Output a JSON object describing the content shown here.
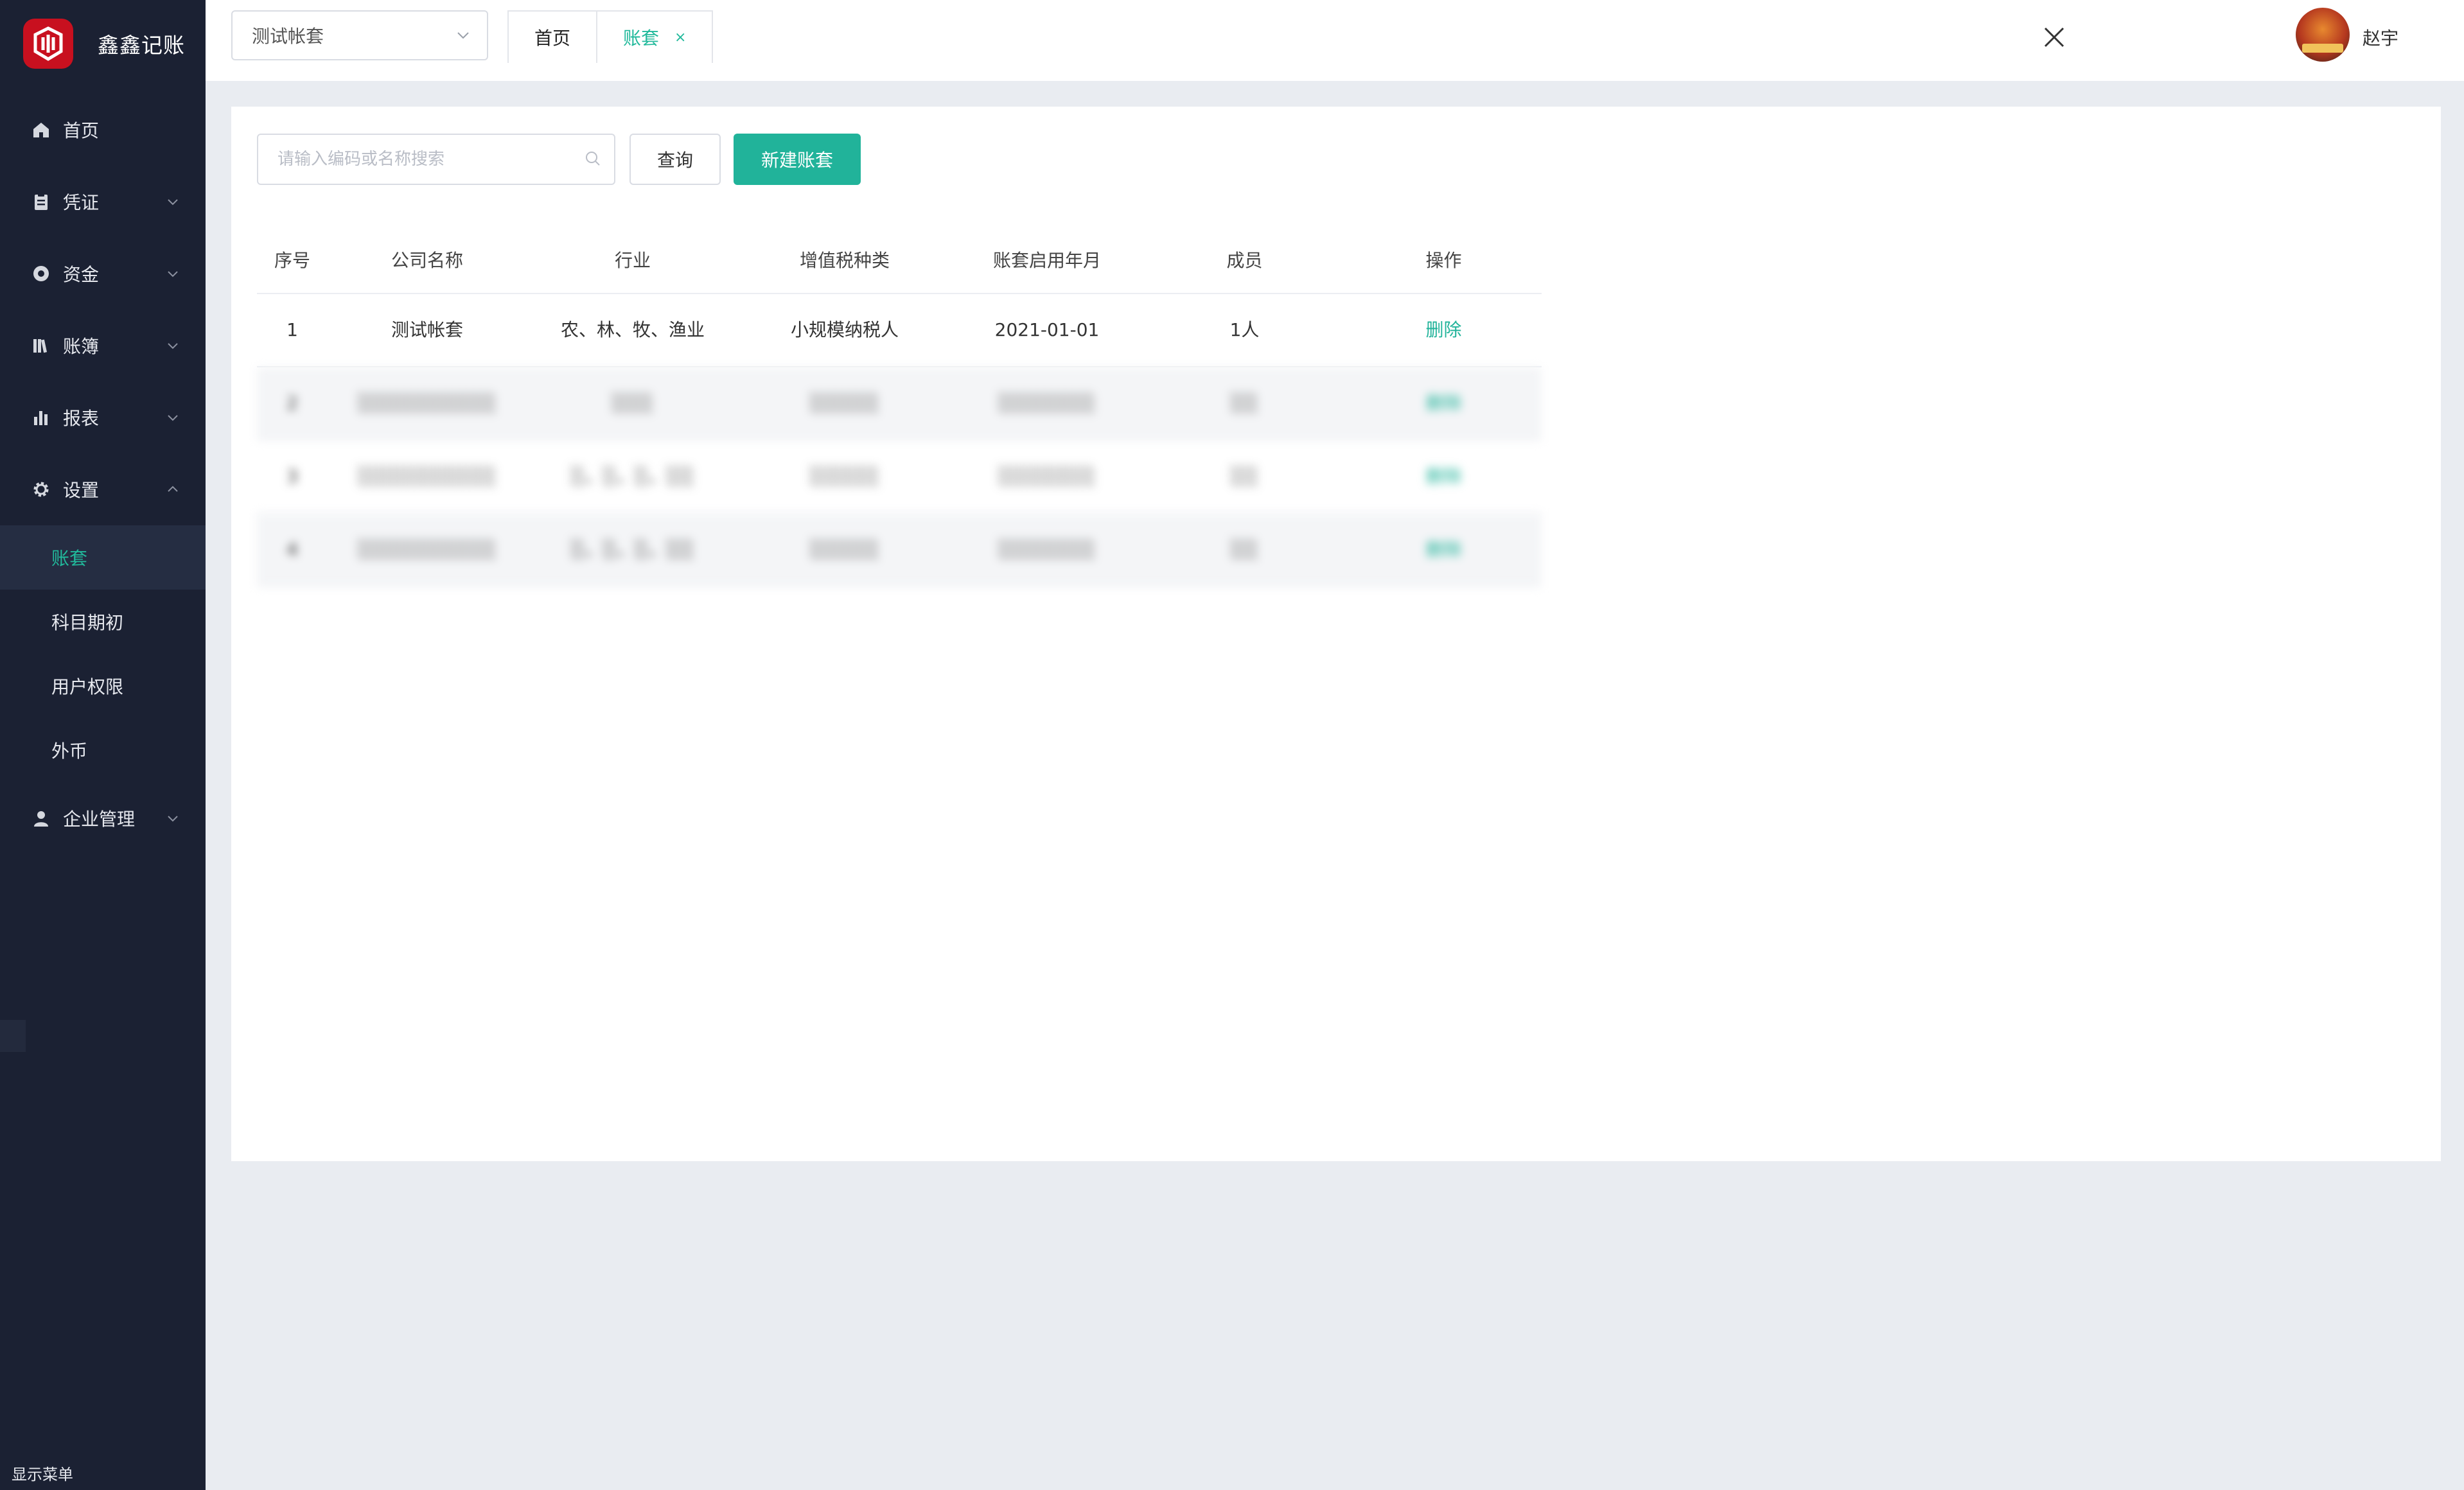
{
  "app": {
    "name": "鑫鑫记账",
    "brand_color": "#c8101f",
    "accent_color": "#21b39a",
    "sidebar_bg": "#1b2133"
  },
  "sidebar": {
    "menu": [
      {
        "label": "首页",
        "icon": "home-icon"
      },
      {
        "label": "凭证",
        "icon": "clipboard-icon"
      },
      {
        "label": "资金",
        "icon": "money-icon"
      },
      {
        "label": "账簿",
        "icon": "books-icon"
      },
      {
        "label": "报表",
        "icon": "bar-chart-icon"
      },
      {
        "label": "设置",
        "icon": "gear-icon"
      }
    ],
    "settings_sub": [
      {
        "label": "账套",
        "active": true
      },
      {
        "label": "科目期初"
      },
      {
        "label": "用户权限"
      },
      {
        "label": "外币"
      }
    ],
    "enterprise": {
      "label": "企业管理",
      "icon": "user-icon"
    },
    "show_menu_label": "显示菜单"
  },
  "header": {
    "book_select_value": "测试帐套",
    "tabs": [
      {
        "label": "首页",
        "active": false
      },
      {
        "label": "账套",
        "active": true,
        "close": "×"
      }
    ],
    "user_name": "赵宇"
  },
  "toolbar": {
    "search_placeholder": "请输入编码或名称搜索",
    "query_label": "查询",
    "new_label": "新建账套"
  },
  "table": {
    "columns": [
      "序号",
      "公司名称",
      "行业",
      "增值税种类",
      "账套启用年月",
      "成员",
      "操作"
    ],
    "rows": [
      {
        "no": "1",
        "company": "测试帐套",
        "industry": "农、林、牧、渔业",
        "vat": "小规模纳税人",
        "start": "2021-01-01",
        "members": "1人",
        "action": "删除"
      },
      {
        "no": "2",
        "company": "░░░░░░░░░░",
        "industry": "░░░",
        "vat": "░░░░░",
        "start": "░░░░░░░",
        "members": "░░",
        "action": "删除"
      },
      {
        "no": "3",
        "company": "░░░░░░░░░░",
        "industry": "░、░、░、░░",
        "vat": "░░░░░",
        "start": "░░░░░░░",
        "members": "░░",
        "action": "删除"
      },
      {
        "no": "4",
        "company": "░░░░░░░░░░",
        "industry": "░、░、░、░░",
        "vat": "░░░░░",
        "start": "░░░░░░░",
        "members": "░░",
        "action": "删除"
      }
    ]
  }
}
